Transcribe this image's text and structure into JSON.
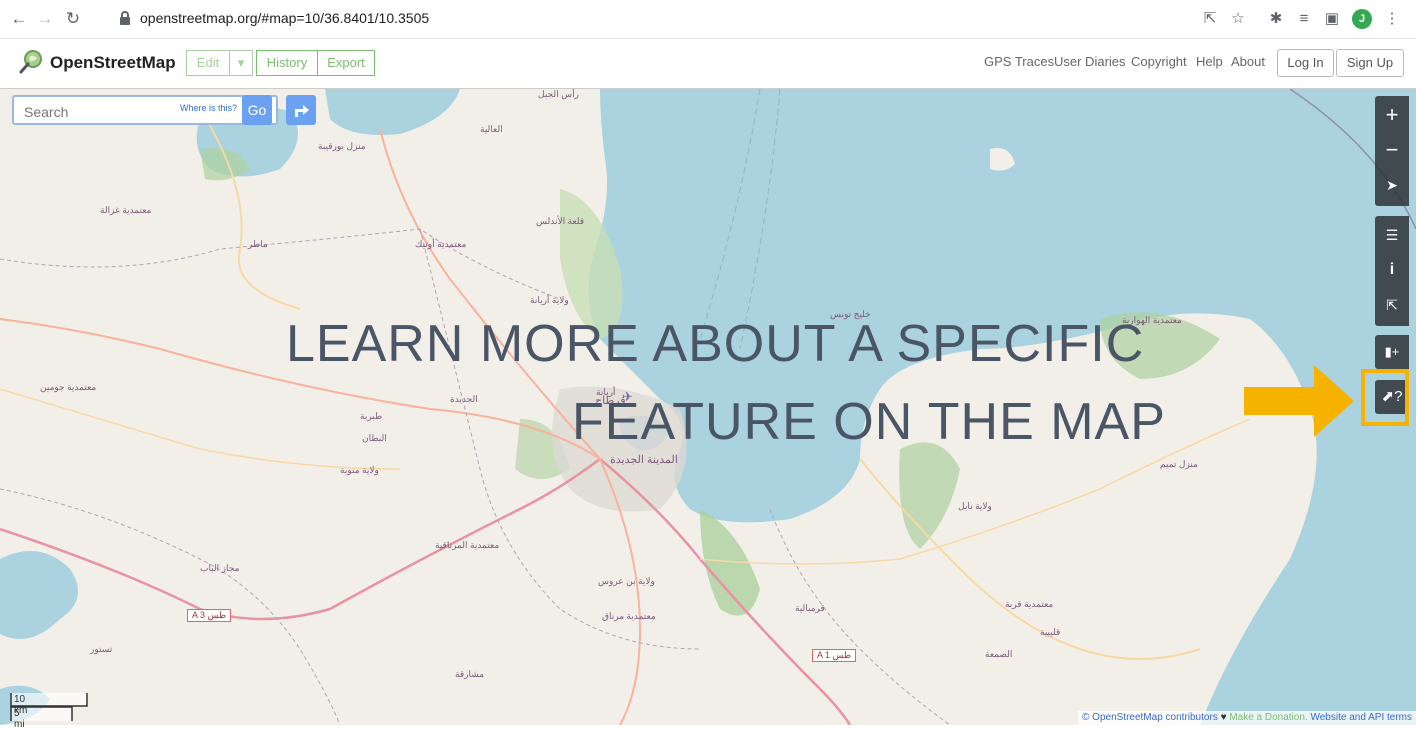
{
  "browser": {
    "url": "openstreetmap.org/#map=10/36.8401/10.3505",
    "profile_initial": "J"
  },
  "header": {
    "logo_text": "OpenStreetMap",
    "edit_label": "Edit",
    "history_label": "History",
    "export_label": "Export",
    "links": [
      "GPS Traces",
      "User Diaries",
      "Copyright",
      "Help",
      "About"
    ],
    "login_label": "Log In",
    "signup_label": "Sign Up",
    "accent_color": "#7ebc6f"
  },
  "search": {
    "placeholder": "Search",
    "where_label": "Where is this?",
    "go_label": "Go"
  },
  "map": {
    "water_color": "#aad3df",
    "land_color": "#f2efe9",
    "forest_color": "#add19e",
    "places": [
      "رأس الجبل",
      "العالية",
      "منزل بورقيبة",
      "معتمدية غزالة",
      "ماطر",
      "معتمدية أوتيك",
      "قلعة الأندلس",
      "ولاية أريانة",
      "خليج تونس",
      "معتمدية الهوارية",
      "قرطاج",
      "أريانة",
      "المدينة الجديدة",
      "ولاية منوبة",
      "ولاية نابل",
      "ولاية بن عروس",
      "معتمدية مرناق",
      "قرمبالية",
      "قليبية",
      "الصمعة",
      "معتمدية قربة",
      "طبربة",
      "البطان",
      "الجديدة",
      "معتمدية المرناقية",
      "مجاز الباب",
      "تستور",
      "منزل تميم",
      "معتمدية جومين",
      "مشارقة"
    ],
    "road_shields": [
      "A 3 طس",
      "A 1 طس"
    ]
  },
  "overlay": {
    "line1": "LEARN MORE ABOUT A SPECIFIC",
    "line2": "FEATURE ON THE MAP",
    "arrow_color": "#f5b300"
  },
  "scale": {
    "km": "10 km",
    "mi": "5 mi"
  },
  "attribution": {
    "contributors": "© OpenStreetMap contributors",
    "heart": "♥",
    "donate": "Make a Donation.",
    "website": "Website and API terms"
  }
}
